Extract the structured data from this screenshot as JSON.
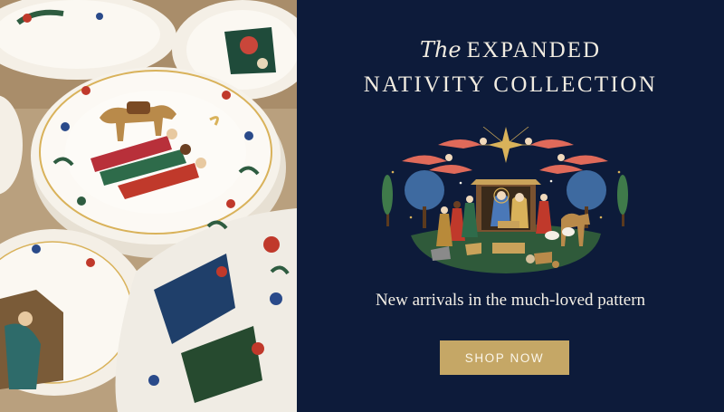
{
  "banner": {
    "heading_script": "The",
    "heading_line1": "EXPANDED",
    "heading_line2": "NATIVITY COLLECTION",
    "subtitle": "New arrivals in the much-loved pattern",
    "cta_label": "SHOP NOW"
  },
  "colors": {
    "panel_background": "#0d1b3a",
    "button_background": "#c5a766",
    "text": "#f3efe6",
    "gold": "#d9b25a",
    "green": "#2f5a3a",
    "red": "#c0392b"
  },
  "icons": {
    "scene": "nativity-illustration",
    "photo": "nativity-plates-photo"
  }
}
